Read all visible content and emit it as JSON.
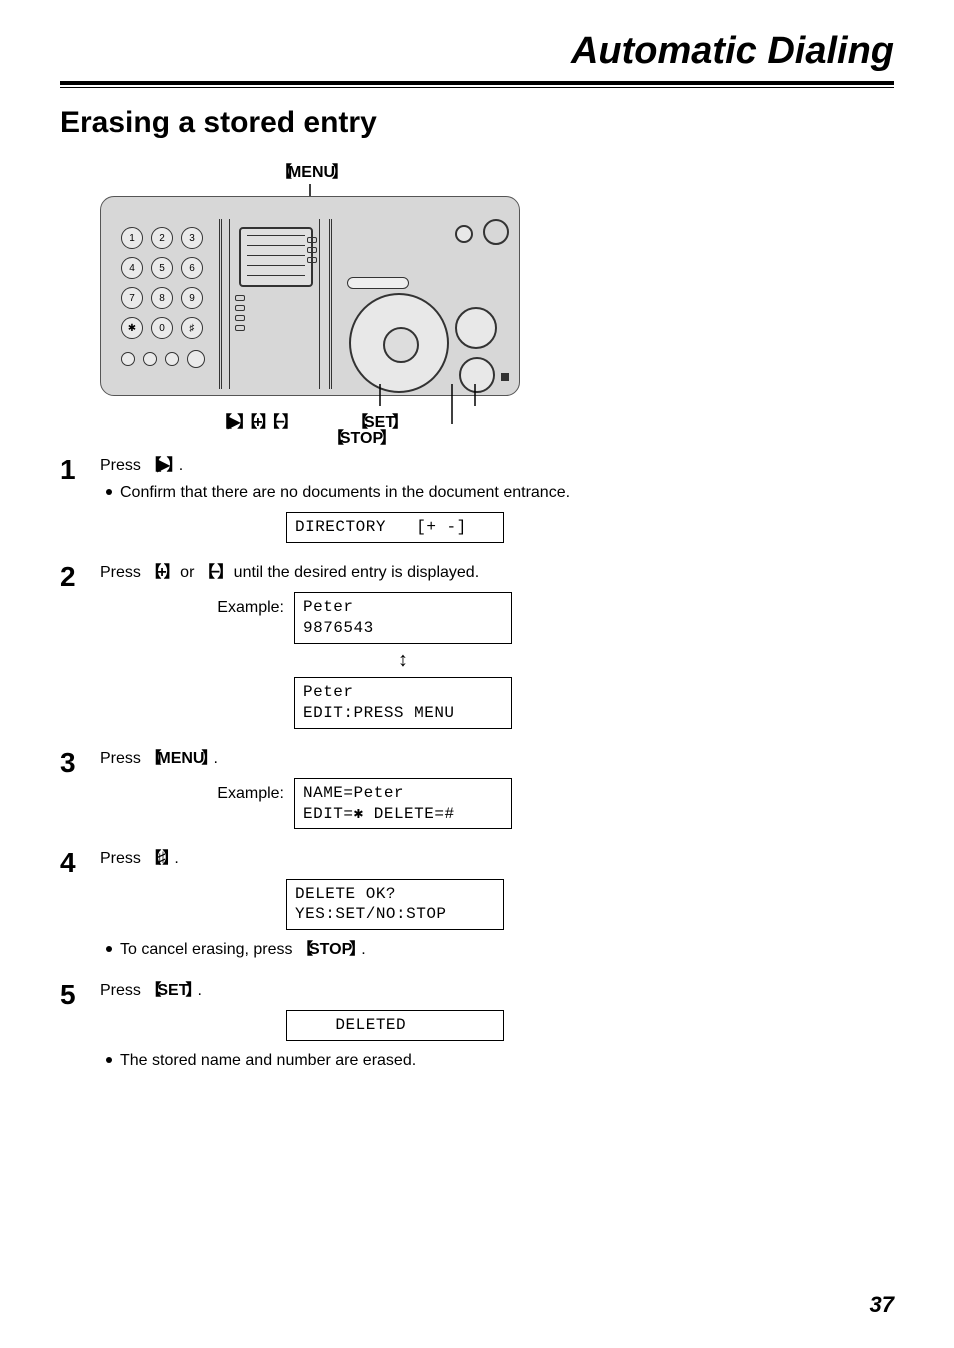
{
  "chapter": "Automatic Dialing",
  "section": "Erasing a stored entry",
  "device_labels": {
    "menu": "MENU",
    "nav_plus_minus": "▶   +   −",
    "set": "SET",
    "stop": "STOP"
  },
  "keypad": {
    "rows": [
      "1",
      "2",
      "3",
      "4",
      "5",
      "6",
      "7",
      "8",
      "9",
      "✱",
      "0",
      "♯"
    ]
  },
  "keys": {
    "right": "▶",
    "plus": "+",
    "minus": "−",
    "menu": "MENU",
    "hash": "♯",
    "set": "SET",
    "stop": "STOP"
  },
  "steps": {
    "s1": {
      "text_a": "Press ",
      "text_b": ".",
      "bullet": "Confirm that there are no documents in the document entrance.",
      "lcd": "DIRECTORY   [+ -]"
    },
    "s2": {
      "text_a": "Press ",
      "text_b": " or ",
      "text_c": " until the desired entry is displayed.",
      "example_label": "Example:",
      "lcd1": "Peter\n9876543",
      "lcd2": "Peter\nEDIT:PRESS MENU"
    },
    "s3": {
      "text_a": "Press ",
      "text_b": ".",
      "example_label": "Example:",
      "lcd": "NAME=Peter\nEDIT=✱ DELETE=#"
    },
    "s4": {
      "text_a": "Press ",
      "text_b": ".",
      "lcd": "DELETE OK?\nYES:SET/NO:STOP",
      "bullet_a": "To cancel erasing, press ",
      "bullet_b": "."
    },
    "s5": {
      "text_a": "Press ",
      "text_b": ".",
      "lcd": "    DELETED",
      "bullet": "The stored name and number are erased."
    }
  },
  "page_number": "37"
}
